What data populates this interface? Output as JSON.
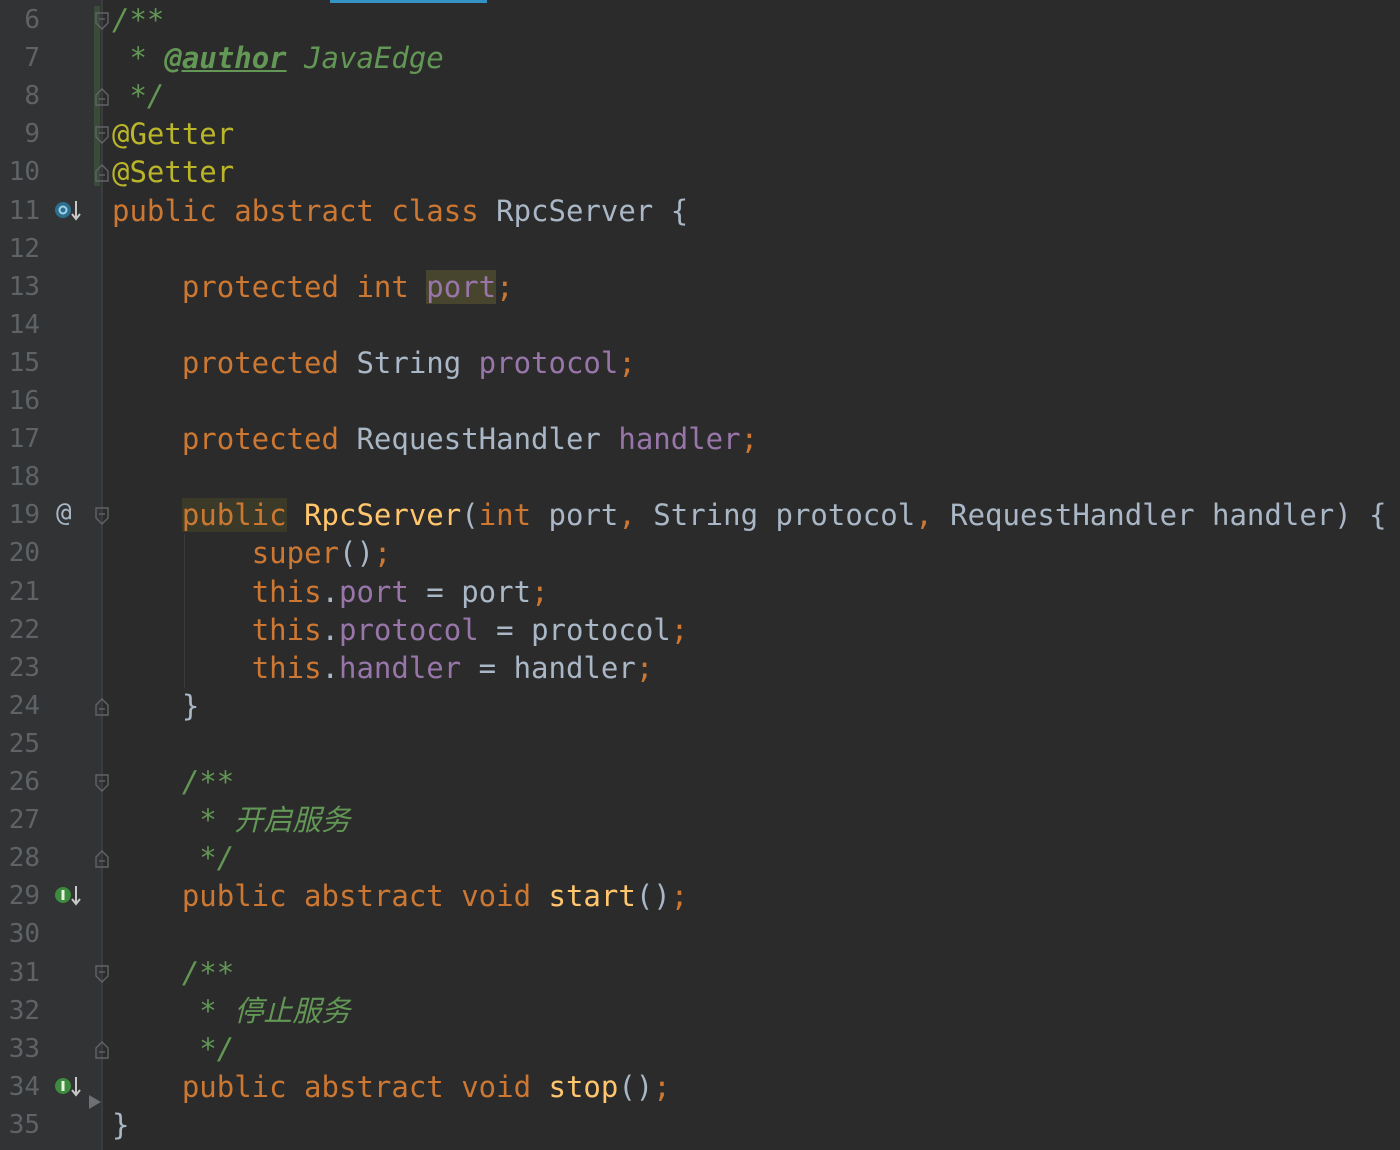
{
  "editor": {
    "language": "Java",
    "lines": [
      {
        "n": "6",
        "segs": [
          {
            "t": "/**",
            "c": "cm"
          }
        ]
      },
      {
        "n": "7",
        "segs": [
          {
            "t": " * ",
            "c": "cm"
          },
          {
            "t": "@author",
            "c": "cmt"
          },
          {
            "t": " JavaEdge",
            "c": "cm"
          }
        ]
      },
      {
        "n": "8",
        "segs": [
          {
            "t": " */",
            "c": "cm"
          }
        ]
      },
      {
        "n": "9",
        "segs": [
          {
            "t": "@Getter",
            "c": "an"
          }
        ]
      },
      {
        "n": "10",
        "segs": [
          {
            "t": "@Setter",
            "c": "an"
          }
        ]
      },
      {
        "n": "11",
        "segs": [
          {
            "t": "public abstract class ",
            "c": "kw"
          },
          {
            "t": "RpcServer {",
            "c": "tx"
          }
        ]
      },
      {
        "n": "12",
        "segs": []
      },
      {
        "n": "13",
        "segs": [
          {
            "t": "    ",
            "c": "tx"
          },
          {
            "t": "protected int ",
            "c": "kw"
          },
          {
            "t": "port",
            "c": "fld hl-port"
          },
          {
            "t": ";",
            "c": "kw"
          }
        ]
      },
      {
        "n": "14",
        "segs": []
      },
      {
        "n": "15",
        "segs": [
          {
            "t": "    ",
            "c": "tx"
          },
          {
            "t": "protected ",
            "c": "kw"
          },
          {
            "t": "String ",
            "c": "tx"
          },
          {
            "t": "protocol",
            "c": "fld"
          },
          {
            "t": ";",
            "c": "kw"
          }
        ]
      },
      {
        "n": "16",
        "segs": []
      },
      {
        "n": "17",
        "segs": [
          {
            "t": "    ",
            "c": "tx"
          },
          {
            "t": "protected ",
            "c": "kw"
          },
          {
            "t": "RequestHandler ",
            "c": "tx"
          },
          {
            "t": "handler",
            "c": "fld"
          },
          {
            "t": ";",
            "c": "kw"
          }
        ]
      },
      {
        "n": "18",
        "segs": []
      },
      {
        "n": "19",
        "segs": [
          {
            "t": "    ",
            "c": "tx"
          },
          {
            "t": "public",
            "c": "kw hl-pub"
          },
          {
            "t": " ",
            "c": "tx"
          },
          {
            "t": "RpcServer",
            "c": "fn"
          },
          {
            "t": "(",
            "c": "tx"
          },
          {
            "t": "int ",
            "c": "kw"
          },
          {
            "t": "port",
            "c": "tx"
          },
          {
            "t": ", ",
            "c": "kw"
          },
          {
            "t": "String protocol",
            "c": "tx"
          },
          {
            "t": ", ",
            "c": "kw"
          },
          {
            "t": "RequestHandler handler) {",
            "c": "tx"
          }
        ]
      },
      {
        "n": "20",
        "segs": [
          {
            "t": "        ",
            "c": "tx"
          },
          {
            "t": "super",
            "c": "kw"
          },
          {
            "t": "()",
            "c": "tx"
          },
          {
            "t": ";",
            "c": "kw"
          }
        ]
      },
      {
        "n": "21",
        "segs": [
          {
            "t": "        ",
            "c": "tx"
          },
          {
            "t": "this",
            "c": "kw"
          },
          {
            "t": ".",
            "c": "tx"
          },
          {
            "t": "port",
            "c": "fld"
          },
          {
            "t": " = port",
            "c": "tx"
          },
          {
            "t": ";",
            "c": "kw"
          }
        ]
      },
      {
        "n": "22",
        "segs": [
          {
            "t": "        ",
            "c": "tx"
          },
          {
            "t": "this",
            "c": "kw"
          },
          {
            "t": ".",
            "c": "tx"
          },
          {
            "t": "protocol",
            "c": "fld"
          },
          {
            "t": " = protocol",
            "c": "tx"
          },
          {
            "t": ";",
            "c": "kw"
          }
        ]
      },
      {
        "n": "23",
        "segs": [
          {
            "t": "        ",
            "c": "tx"
          },
          {
            "t": "this",
            "c": "kw"
          },
          {
            "t": ".",
            "c": "tx"
          },
          {
            "t": "handler",
            "c": "fld"
          },
          {
            "t": " = handler",
            "c": "tx"
          },
          {
            "t": ";",
            "c": "kw"
          }
        ]
      },
      {
        "n": "24",
        "segs": [
          {
            "t": "    }",
            "c": "tx"
          }
        ]
      },
      {
        "n": "25",
        "segs": []
      },
      {
        "n": "26",
        "segs": [
          {
            "t": "    ",
            "c": "tx"
          },
          {
            "t": "/**",
            "c": "cm"
          }
        ]
      },
      {
        "n": "27",
        "segs": [
          {
            "t": "    ",
            "c": "tx"
          },
          {
            "t": " * 开启服务",
            "c": "cm"
          }
        ]
      },
      {
        "n": "28",
        "segs": [
          {
            "t": "    ",
            "c": "tx"
          },
          {
            "t": " */",
            "c": "cm"
          }
        ]
      },
      {
        "n": "29",
        "segs": [
          {
            "t": "    ",
            "c": "tx"
          },
          {
            "t": "public abstract void ",
            "c": "kw"
          },
          {
            "t": "start",
            "c": "fn"
          },
          {
            "t": "()",
            "c": "tx"
          },
          {
            "t": ";",
            "c": "kw"
          }
        ]
      },
      {
        "n": "30",
        "segs": []
      },
      {
        "n": "31",
        "segs": [
          {
            "t": "    ",
            "c": "tx"
          },
          {
            "t": "/**",
            "c": "cm"
          }
        ]
      },
      {
        "n": "32",
        "segs": [
          {
            "t": "    ",
            "c": "tx"
          },
          {
            "t": " * 停止服务",
            "c": "cm"
          }
        ]
      },
      {
        "n": "33",
        "segs": [
          {
            "t": "    ",
            "c": "tx"
          },
          {
            "t": " */",
            "c": "cm"
          }
        ]
      },
      {
        "n": "34",
        "segs": [
          {
            "t": "    ",
            "c": "tx"
          },
          {
            "t": "public abstract void ",
            "c": "kw"
          },
          {
            "t": "stop",
            "c": "fn"
          },
          {
            "t": "()",
            "c": "tx"
          },
          {
            "t": ";",
            "c": "kw"
          }
        ]
      },
      {
        "n": "35",
        "segs": [
          {
            "t": "}",
            "c": "tx"
          }
        ]
      }
    ],
    "gutter_icons": [
      {
        "line": "11",
        "icon": "overridden-method-icon"
      },
      {
        "line": "19",
        "icon": "annotation-at-icon",
        "text": "@"
      },
      {
        "line": "29",
        "icon": "implemented-method-icon"
      },
      {
        "line": "34",
        "icon": "implemented-method-icon"
      }
    ]
  }
}
